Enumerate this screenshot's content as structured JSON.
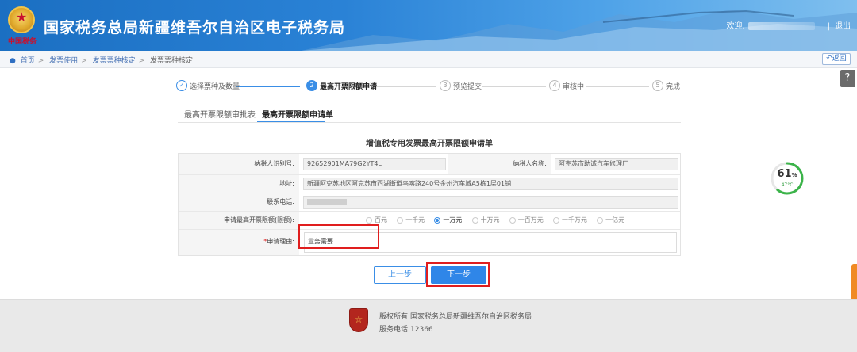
{
  "header": {
    "title": "国家税务总局新疆维吾尔自治区电子税务局",
    "emblem_text": "中国税务",
    "welcome": "欢迎,",
    "logout": "退出"
  },
  "breadcrumb": {
    "items": [
      "首页",
      "发票使用",
      "发票票种核定",
      "发票票种核定"
    ],
    "back": "返回"
  },
  "help": "?",
  "steps": [
    {
      "num": "✓",
      "label": "选择票种及数量",
      "state": "done"
    },
    {
      "num": "2",
      "label": "最高开票限额申请",
      "state": "active"
    },
    {
      "num": "3",
      "label": "预览提交",
      "state": "pending"
    },
    {
      "num": "4",
      "label": "审核中",
      "state": "pending"
    },
    {
      "num": "5",
      "label": "完成",
      "state": "pending"
    }
  ],
  "tabs": [
    {
      "label": "最高开票限额审批表",
      "active": false
    },
    {
      "label": "最高开票限额申请单",
      "active": true
    }
  ],
  "form": {
    "title": "增值税专用发票最高开票限额申请单",
    "taxpayer_id_label": "纳税人识别号:",
    "taxpayer_id": "92652901MA79G2YT4L",
    "taxpayer_name_label": "纳税人名称:",
    "taxpayer_name": "阿克苏市助诚汽车修理厂",
    "address_label": "地址:",
    "address": "新疆阿克苏地区阿克苏市西湖街道乌喀路240号金州汽车城A5栋1层01铺",
    "contact_label": "联系电话:",
    "limit_label": "申请最高开票限额(限额)",
    "limit_colon": ":",
    "limit_options": [
      {
        "label": "百元",
        "checked": false
      },
      {
        "label": "一千元",
        "checked": false
      },
      {
        "label": "一万元",
        "checked": true
      },
      {
        "label": "十万元",
        "checked": false
      },
      {
        "label": "一百万元",
        "checked": false
      },
      {
        "label": "一千万元",
        "checked": false
      },
      {
        "label": "一亿元",
        "checked": false
      }
    ],
    "reason_required": "*",
    "reason_label": "申请理由:",
    "reason_value": "业务需要"
  },
  "buttons": {
    "prev": "上一步",
    "next": "下一步"
  },
  "gauge": {
    "percent": "61",
    "unit": "%",
    "temp": "47°C",
    "fraction": 0.61,
    "color": "#3cb44a"
  },
  "footer": {
    "copyright": "版权所有:国家税务总局新疆维吾尔自治区税务局",
    "phone": "服务电话:12366"
  },
  "colors": {
    "accent": "#3a8ee6",
    "highlight": "#e01e1e"
  }
}
